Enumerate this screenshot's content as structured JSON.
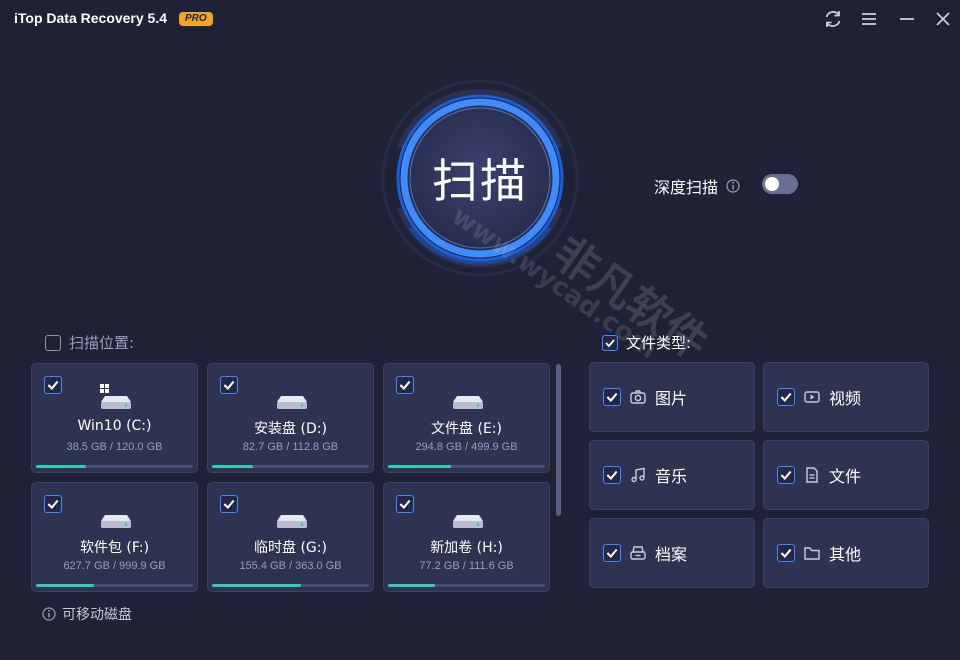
{
  "app": {
    "title": "iTop Data Recovery 5.4",
    "badge": "PRO"
  },
  "titlebar": {
    "buttons": [
      "refresh-icon",
      "menu-icon",
      "minimize-icon",
      "close-icon"
    ]
  },
  "scan": {
    "label": "扫描"
  },
  "deep_scan": {
    "label": "深度扫描",
    "enabled": false
  },
  "locations": {
    "header": "扫描位置:",
    "drives": [
      {
        "name": "Win10 (C:)",
        "size": "38.5 GB / 120.0 GB",
        "used_fraction": 0.32,
        "checked": true,
        "system": true
      },
      {
        "name": "安装盘 (D:)",
        "size": "82.7 GB / 112.8 GB",
        "used_fraction": 0.26,
        "checked": true,
        "system": false
      },
      {
        "name": "文件盘 (E:)",
        "size": "294.8 GB / 499.9 GB",
        "used_fraction": 0.4,
        "checked": true,
        "system": false
      },
      {
        "name": "软件包 (F:)",
        "size": "627.7 GB / 999.9 GB",
        "used_fraction": 0.37,
        "checked": true,
        "system": false
      },
      {
        "name": "临时盘 (G:)",
        "size": "155.4 GB / 363.0 GB",
        "used_fraction": 0.57,
        "checked": true,
        "system": false
      },
      {
        "name": "新加卷 (H:)",
        "size": "77.2 GB / 111.6 GB",
        "used_fraction": 0.3,
        "checked": true,
        "system": false
      }
    ],
    "removable_label": "可移动磁盘"
  },
  "file_types": {
    "header": "文件类型:",
    "items": [
      {
        "label": "图片",
        "icon": "camera-icon",
        "checked": true
      },
      {
        "label": "视频",
        "icon": "video-icon",
        "checked": true
      },
      {
        "label": "音乐",
        "icon": "music-icon",
        "checked": true
      },
      {
        "label": "文件",
        "icon": "document-icon",
        "checked": true
      },
      {
        "label": "档案",
        "icon": "archive-icon",
        "checked": true
      },
      {
        "label": "其他",
        "icon": "folder-icon",
        "checked": true
      }
    ]
  },
  "watermark": {
    "text_cn": "非凡软件",
    "text_url": "www.wycad.com"
  },
  "colors": {
    "background": "#1f2237",
    "card": "#2f3352",
    "accent_blue": "#3f8cff",
    "progress": "#2bd1b3",
    "badge": "#f2a620"
  }
}
